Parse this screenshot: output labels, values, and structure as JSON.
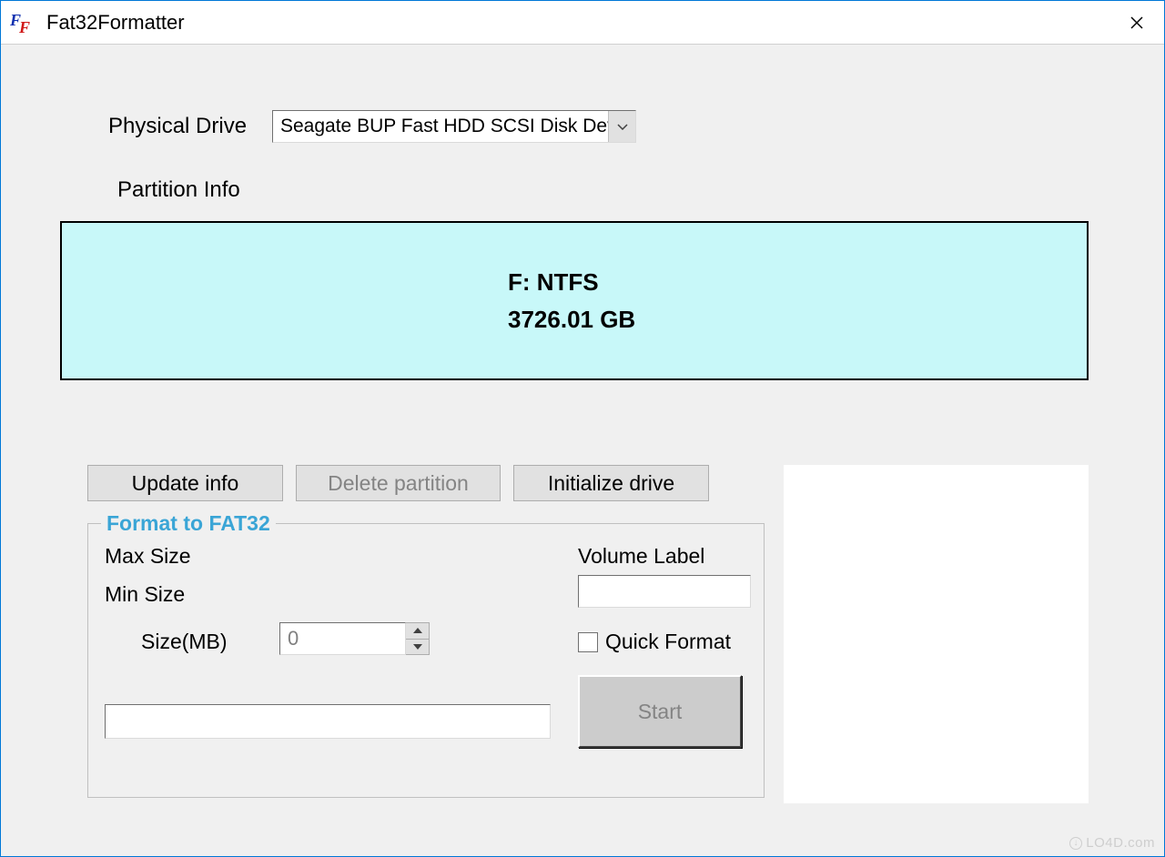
{
  "window": {
    "title": "Fat32Formatter"
  },
  "drive": {
    "label": "Physical Drive",
    "selected": "Seagate BUP Fast HDD SCSI Disk Device"
  },
  "partition_info_label": "Partition Info",
  "partition": {
    "line1": "F: NTFS",
    "line2": "3726.01 GB"
  },
  "buttons": {
    "update": "Update info",
    "delete": "Delete partition",
    "initialize": "Initialize drive"
  },
  "format_group": {
    "legend": "Format to FAT32",
    "max_size_label": "Max Size",
    "min_size_label": "Min Size",
    "size_mb_label": "Size(MB)",
    "size_value": "0",
    "volume_label_label": "Volume Label",
    "volume_label_value": "",
    "quick_format_label": "Quick Format",
    "start_label": "Start"
  },
  "watermark": "LO4D.com"
}
